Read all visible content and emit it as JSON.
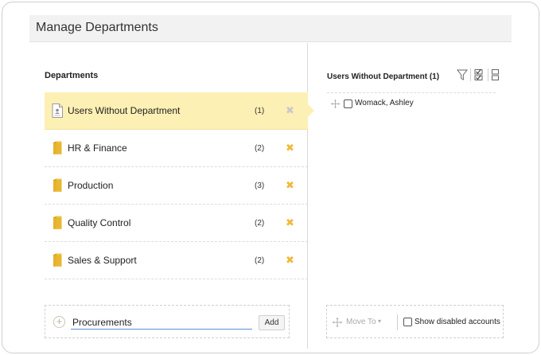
{
  "header": {
    "title": "Manage Departments"
  },
  "departments": {
    "title": "Departments",
    "items": [
      {
        "name": "Users Without Department",
        "count": "(1)",
        "icon": "user-document-icon",
        "selected": true
      },
      {
        "name": "HR & Finance",
        "count": "(2)",
        "icon": "folder-icon",
        "selected": false
      },
      {
        "name": "Production",
        "count": "(3)",
        "icon": "folder-icon",
        "selected": false
      },
      {
        "name": "Quality Control",
        "count": "(2)",
        "icon": "folder-icon",
        "selected": false
      },
      {
        "name": "Sales & Support",
        "count": "(2)",
        "icon": "folder-icon",
        "selected": false
      }
    ],
    "delete_glyph": "✖",
    "add": {
      "value": "Procurements",
      "button_label": "Add",
      "icon_glyph": "+"
    }
  },
  "users_panel": {
    "title": "Users Without Department (1)",
    "toolbar_icons": [
      "filter-icon",
      "check-all-icon",
      "uncheck-all-icon"
    ],
    "users": [
      {
        "name": "Womack, Ashley"
      }
    ],
    "footer": {
      "move_to_label": "Move To",
      "move_caret": "▾",
      "show_disabled_label": "Show disabled accounts"
    }
  },
  "colors": {
    "selected_row": "#fdf0b4",
    "delete_icon": "#f0b93b",
    "header_bg": "#f2f2f2",
    "input_underline": "#5b8fd6"
  }
}
